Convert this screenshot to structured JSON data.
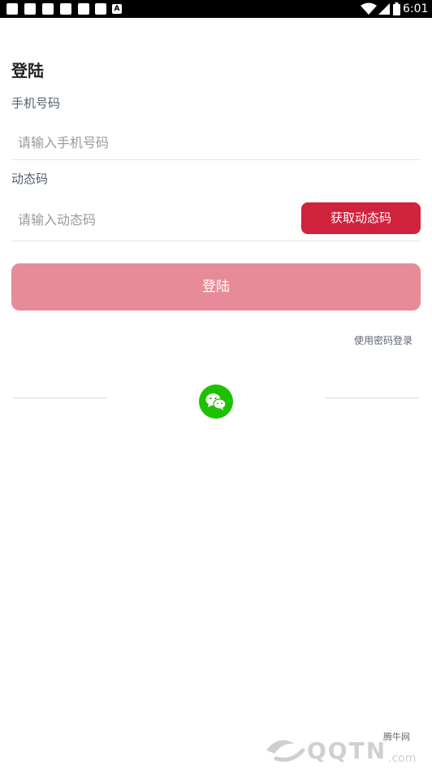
{
  "status_bar": {
    "time": "6:01",
    "notification_icons": [
      "app-icon",
      "app-icon",
      "app-icon",
      "app-icon",
      "app-icon",
      "app-icon"
    ],
    "badge_letter": "A"
  },
  "login": {
    "title": "登陆",
    "phone_label": "手机号码",
    "phone_placeholder": "请输入手机号码",
    "code_label": "动态码",
    "code_placeholder": "请输入动态码",
    "get_code_button": "获取动态码",
    "submit_button": "登陆",
    "password_login_link": "使用密码登录"
  },
  "social": {
    "icon": "wechat-icon"
  },
  "watermark": {
    "text": "腾牛网"
  },
  "colors": {
    "accent": "#d0213d",
    "login_button": "#e88b98",
    "wechat": "#1ec100"
  }
}
